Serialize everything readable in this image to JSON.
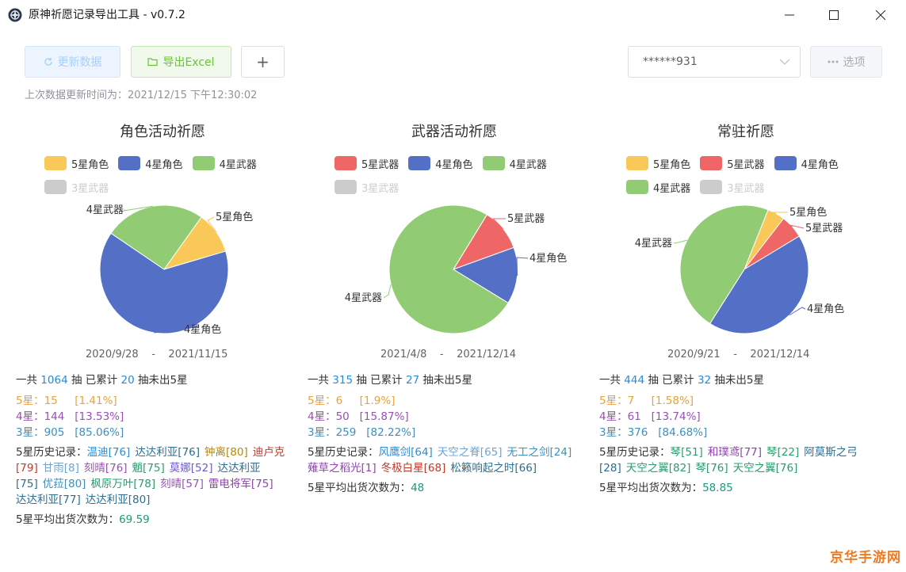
{
  "window": {
    "title": "原神祈愿记录导出工具 - v0.7.2",
    "icons": {
      "app": "genshin-icon",
      "minimize": "minimize-icon",
      "maximize": "maximize-icon",
      "close": "close-icon"
    }
  },
  "toolbar": {
    "refresh_label": "更新数据",
    "export_label": "导出Excel",
    "add_label": "+",
    "account_value": "******931",
    "options_label": "选项",
    "last_update": "上次数据更新时间为：2021/12/15 下午12:30:02"
  },
  "colors": {
    "five_char": "#fac858",
    "five_weapon": "#ee6666",
    "four_char": "#5470c6",
    "four_weapon": "#91cc75",
    "three_weapon": "#cccccc",
    "five": "#e6a23c",
    "four": "#9b4fb8",
    "three": "#3d8fbd"
  },
  "panels": [
    {
      "title": "角色活动祈愿",
      "legend": [
        "5星角色",
        "4星角色",
        "4星武器",
        "3星武器"
      ],
      "date_from": "2020/9/28",
      "date_to": "2021/11/15",
      "total_prefix": "一共",
      "total": "1064",
      "total_mid": "抽 已累计",
      "pity": "20",
      "total_suffix": "抽未出5星",
      "five_label": "5星：",
      "five_count": "15",
      "five_pct": "[1.41%]",
      "four_label": "4星：",
      "four_count": "144",
      "four_pct": "[13.53%]",
      "three_label": "3星：",
      "three_count": "905",
      "three_pct": "[85.06%]",
      "history_label": "5星历史记录：",
      "history": [
        {
          "text": "温迪[76]",
          "color": "#2a8bd6"
        },
        {
          "text": "达达利亚[76]",
          "color": "#2c6e8f"
        },
        {
          "text": "钟离[80]",
          "color": "#b8860b"
        },
        {
          "text": "迪卢克[79]",
          "color": "#c0392b"
        },
        {
          "text": "甘雨[8]",
          "color": "#6aa5d8"
        },
        {
          "text": "刻晴[76]",
          "color": "#9b4fb8"
        },
        {
          "text": "魈[75]",
          "color": "#2a9d6c"
        },
        {
          "text": "莫娜[52]",
          "color": "#6a5acd"
        },
        {
          "text": "达达利亚[75]",
          "color": "#2c6e8f"
        },
        {
          "text": "优菈[80]",
          "color": "#3d8fbd"
        },
        {
          "text": "枫原万叶[78]",
          "color": "#2a9d6c"
        },
        {
          "text": "刻晴[57]",
          "color": "#9b4fb8"
        },
        {
          "text": "雷电将军[75]",
          "color": "#8e44ad"
        },
        {
          "text": "达达利亚[77]",
          "color": "#2c6e8f"
        },
        {
          "text": "达达利亚[80]",
          "color": "#2c6e8f"
        }
      ],
      "avg_label": "5星平均出货次数为：",
      "avg": "69.59",
      "chart_data": {
        "type": "pie",
        "title": "角色活动祈愿",
        "slices": [
          {
            "name": "5星角色",
            "value": 15,
            "color": "#fac858"
          },
          {
            "name": "4星角色",
            "value": 91,
            "color": "#5470c6"
          },
          {
            "name": "4星武器",
            "value": 36,
            "color": "#91cc75"
          }
        ],
        "legend_placement": "top"
      }
    },
    {
      "title": "武器活动祈愿",
      "legend": [
        "5星武器",
        "4星角色",
        "4星武器",
        "3星武器"
      ],
      "date_from": "2021/4/8",
      "date_to": "2021/12/14",
      "total_prefix": "一共",
      "total": "315",
      "total_mid": "抽 已累计",
      "pity": "27",
      "total_suffix": "抽未出5星",
      "five_label": "5星：",
      "five_count": "6",
      "five_pct": "[1.9%]",
      "four_label": "4星：",
      "four_count": "50",
      "four_pct": "[15.87%]",
      "three_label": "3星：",
      "three_count": "259",
      "three_pct": "[82.22%]",
      "history_label": "5星历史记录：",
      "history": [
        {
          "text": "风鹰剑[64]",
          "color": "#2a8bd6"
        },
        {
          "text": "天空之脊[65]",
          "color": "#6aa5d8"
        },
        {
          "text": "无工之剑[24]",
          "color": "#3d8fbd"
        },
        {
          "text": "薙草之稻光[1]",
          "color": "#8e44ad"
        },
        {
          "text": "冬极白星[68]",
          "color": "#c0392b"
        },
        {
          "text": "松籁响起之时[66]",
          "color": "#2c6e8f"
        }
      ],
      "avg_label": "5星平均出货次数为：",
      "avg": "48",
      "chart_data": {
        "type": "pie",
        "title": "武器活动祈愿",
        "slices": [
          {
            "name": "5星武器",
            "value": 6,
            "color": "#ee6666"
          },
          {
            "name": "4星角色",
            "value": 8,
            "color": "#5470c6"
          },
          {
            "name": "4星武器",
            "value": 42,
            "color": "#91cc75"
          }
        ],
        "legend_placement": "top"
      }
    },
    {
      "title": "常驻祈愿",
      "legend": [
        "5星角色",
        "5星武器",
        "4星角色",
        "4星武器",
        "3星武器"
      ],
      "date_from": "2020/9/21",
      "date_to": "2021/12/14",
      "total_prefix": "一共",
      "total": "444",
      "total_mid": "抽 已累计",
      "pity": "32",
      "total_suffix": "抽未出5星",
      "five_label": "5星：",
      "five_count": "7",
      "five_pct": "[1.58%]",
      "four_label": "4星：",
      "four_count": "61",
      "four_pct": "[13.74%]",
      "three_label": "3星：",
      "three_count": "376",
      "three_pct": "[84.68%]",
      "history_label": "5星历史记录：",
      "history": [
        {
          "text": "琴[51]",
          "color": "#2a9d6c"
        },
        {
          "text": "和璞鸢[77]",
          "color": "#8e44ad"
        },
        {
          "text": "琴[22]",
          "color": "#2a9d6c"
        },
        {
          "text": "阿莫斯之弓[28]",
          "color": "#2c6e8f"
        },
        {
          "text": "天空之翼[82]",
          "color": "#2a9d6c"
        },
        {
          "text": "琴[76]",
          "color": "#2a9d6c"
        },
        {
          "text": "天空之翼[76]",
          "color": "#2a9d6c"
        }
      ],
      "avg_label": "5星平均出货次数为：",
      "avg": "58.85",
      "chart_data": {
        "type": "pie",
        "title": "常驻祈愿",
        "slices": [
          {
            "name": "5星角色",
            "value": 3,
            "color": "#fac858"
          },
          {
            "name": "5星武器",
            "value": 4,
            "color": "#ee6666"
          },
          {
            "name": "4星角色",
            "value": 29,
            "color": "#5470c6"
          },
          {
            "name": "4星武器",
            "value": 32,
            "color": "#91cc75"
          }
        ],
        "legend_placement": "top"
      }
    }
  ],
  "watermark": "京华手游网"
}
